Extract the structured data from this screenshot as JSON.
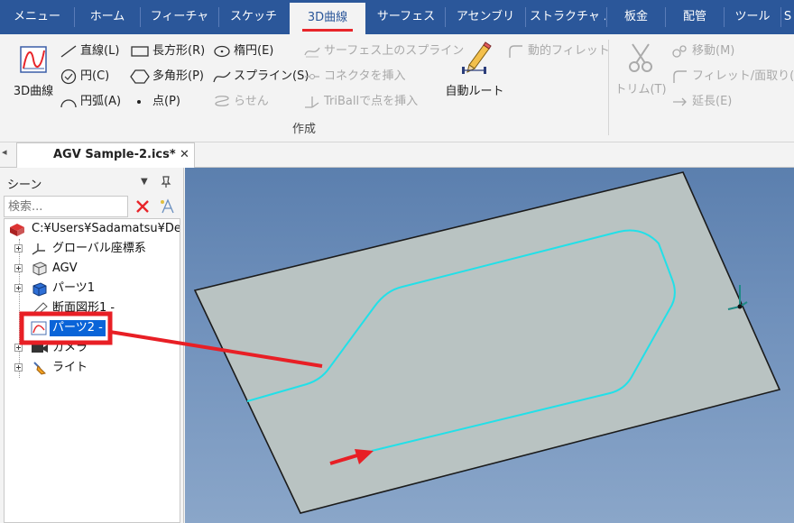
{
  "menu_tabs": [
    {
      "label": "メニュー",
      "active": false
    },
    {
      "label": "ホーム",
      "active": false
    },
    {
      "label": "フィーチャ",
      "active": false
    },
    {
      "label": "スケッチ",
      "active": false
    },
    {
      "label": "3D曲線",
      "active": true
    },
    {
      "label": "サーフェス",
      "active": false
    },
    {
      "label": "アセンブリ",
      "active": false
    },
    {
      "label": "ストラクチャ パー",
      "active": false
    },
    {
      "label": "板金",
      "active": false
    },
    {
      "label": "配管",
      "active": false
    },
    {
      "label": "ツール",
      "active": false
    },
    {
      "label": "S",
      "active": false
    }
  ],
  "ribbon": {
    "big_3dcurve": "3D曲線",
    "line": "直線(L)",
    "rectangle": "長方形(R)",
    "ellipse": "楕円(E)",
    "surface_spline": "サーフェス上のスプライン",
    "circle": "円(C)",
    "polygon": "多角形(P)",
    "spline": "スプライン(S)",
    "insert_connector": "コネクタを挿入",
    "arc": "円弧(A)",
    "point": "点(P)",
    "helix": "らせん",
    "triball_point": "TriBallで点を挿入",
    "auto_route": "自動ルート",
    "dynamic_fillet": "動的フィレット",
    "group_create": "作成",
    "trim": "トリム(T)",
    "move": "移動(M)",
    "fillet_chamfer": "フィレット/面取り(F)",
    "extend": "延長(E)"
  },
  "doc_tab": {
    "title": "AGV Sample-2.ics*",
    "close": "✕",
    "scroll_left": "◂"
  },
  "scene_panel": {
    "title": "シーン",
    "dropdown_glyph": "▼",
    "pin_glyph": "📌",
    "search_placeholder": "検索...",
    "tree": [
      {
        "label": "C:¥Users¥Sadamatsu¥De",
        "icon": "scene-root-icon",
        "indent": 0,
        "expander": false
      },
      {
        "label": "グローバル座標系",
        "icon": "axes-icon",
        "indent": 1,
        "expander": true
      },
      {
        "label": "AGV",
        "icon": "assembly-icon",
        "indent": 1,
        "expander": true
      },
      {
        "label": "パーツ1",
        "icon": "part-icon",
        "indent": 1,
        "expander": true
      },
      {
        "label": "断面図形1 -",
        "icon": "section-icon",
        "indent": 1,
        "expander": false
      },
      {
        "label": "パーツ2 -",
        "icon": "curve-part-icon",
        "indent": 1,
        "expander": false,
        "selected": true
      },
      {
        "label": "カメラ",
        "icon": "camera-icon",
        "indent": 1,
        "expander": true
      },
      {
        "label": "ライト",
        "icon": "light-icon",
        "indent": 1,
        "expander": true
      }
    ]
  },
  "colors": {
    "menubar": "#2b579a",
    "active_underline": "#e8252a",
    "highlight_red": "#e81f25",
    "selection_blue": "#0a64d8",
    "curve_cyan": "#22e0e8",
    "plate_fill": "#b9c3c2"
  }
}
